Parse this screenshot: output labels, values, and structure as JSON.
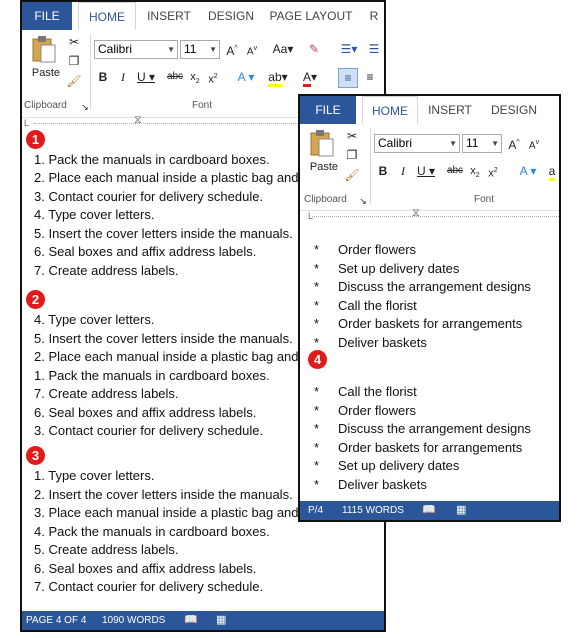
{
  "win1": {
    "tabs": [
      "FILE",
      "HOME",
      "INSERT",
      "DESIGN",
      "PAGE LAYOUT",
      "R"
    ],
    "font_name": "Calibri",
    "font_size": "11",
    "paste_label": "Paste",
    "group_clipboard": "Clipboard",
    "group_font": "Font",
    "list1": [
      "1. Pack the manuals in cardboard boxes.",
      "2. Place each manual inside a plastic bag and",
      "3. Contact courier for delivery schedule.",
      "4. Type cover letters.",
      "5. Insert the cover letters inside the manuals.",
      "6. Seal boxes and affix address labels.",
      "7. Create address labels."
    ],
    "list2": [
      "4. Type cover letters.",
      "5. Insert the cover letters inside the manuals.",
      "2. Place each manual inside a plastic bag and",
      "1. Pack the manuals in cardboard boxes.",
      "7. Create address labels.",
      "6. Seal boxes and affix address labels.",
      "3. Contact courier for delivery schedule."
    ],
    "list3": [
      "1. Type cover letters.",
      "2. Insert the cover letters inside the manuals.",
      "3. Place each manual inside a plastic bag and",
      "4. Pack the manuals in cardboard boxes.",
      "5. Create address labels.",
      "6. Seal boxes and affix address labels.",
      "7. Contact courier for delivery schedule."
    ],
    "badges": [
      "1",
      "2",
      "3"
    ],
    "status_page": "PAGE 4 OF 4",
    "status_words": "1090 WORDS"
  },
  "win2": {
    "tabs": [
      "FILE",
      "HOME",
      "INSERT",
      "DESIGN"
    ],
    "font_name": "Calibri",
    "font_size": "11",
    "paste_label": "Paste",
    "group_clipboard": "Clipboard",
    "group_font": "Font",
    "bullet_char": "*",
    "list_a": [
      "Order flowers",
      "Set up delivery dates",
      "Discuss the arrangement designs",
      "Call the florist",
      "Order baskets for arrangements",
      "Deliver baskets"
    ],
    "list_b": [
      "Call the florist",
      "Order flowers",
      "Discuss the arrangement designs",
      "Order baskets for arrangements",
      "Set up delivery dates",
      "Deliver baskets"
    ],
    "badge": "4",
    "status_page": "P/4",
    "status_words": "1115 WORDS"
  },
  "colors": {
    "accent": "#2b579a",
    "badge": "#e21a1a"
  }
}
